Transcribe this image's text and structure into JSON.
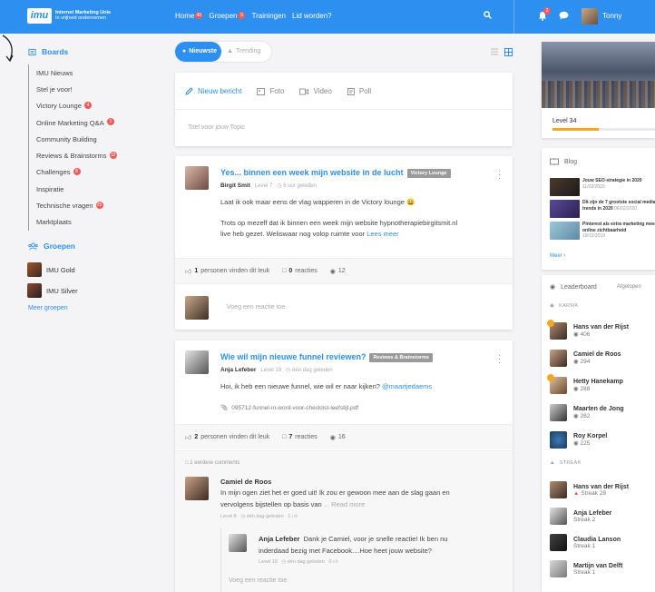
{
  "header": {
    "logo": "imu",
    "brand_title": "Internet Marketing Unie",
    "brand_sub": "In vrijheid ondernemen",
    "nav": [
      {
        "label": "Home",
        "badge": "40"
      },
      {
        "label": "Groepen",
        "badge": "9"
      },
      {
        "label": "Trainingen",
        "badge": ""
      },
      {
        "label": "Lid worden?",
        "badge": ""
      }
    ],
    "notif_count": "2",
    "user_name": "Tonny",
    "colors": {
      "primary": "#2d8ff0",
      "badge": "#f05a5a"
    }
  },
  "sidebar": {
    "boards_title": "Boards",
    "boards": [
      {
        "label": "IMU Nieuws",
        "badge": ""
      },
      {
        "label": "Stel je voor!",
        "badge": ""
      },
      {
        "label": "Victory Lounge",
        "badge": "4"
      },
      {
        "label": "Online Marketing Q&A",
        "badge": "3"
      },
      {
        "label": "Community Building",
        "badge": ""
      },
      {
        "label": "Reviews & Brainstorms",
        "badge": "15"
      },
      {
        "label": "Challenges",
        "badge": "8"
      },
      {
        "label": "Inspiratie",
        "badge": ""
      },
      {
        "label": "Technische vragen",
        "badge": "25"
      },
      {
        "label": "Marktplaats",
        "badge": ""
      }
    ],
    "groups_title": "Groepen",
    "groups": [
      {
        "label": "IMU Gold"
      },
      {
        "label": "IMU Silver"
      }
    ],
    "more_groups": "Meer groepen"
  },
  "feed": {
    "tabs": [
      {
        "label": "Nieuwste"
      },
      {
        "label": "Trending"
      }
    ],
    "composer": {
      "tabs": [
        "Nieuw bericht",
        "Foto",
        "Video",
        "Poll"
      ],
      "placeholder": "Titel voor jouw Topic"
    },
    "posts": [
      {
        "title": "Yes... binnen een week mijn website in de lucht",
        "tag": "Victory Lounge",
        "author": "Birgit Smit",
        "level": "Level 7",
        "time": "6 uur geleden",
        "line1": "Laat ik ook maar eens de vlag wapperen in de Victory lounge 😀",
        "line2": "Trots op mezelf dat ik binnen een week mijn website hypnotherapiebirgitsmit.nl",
        "line3": "live heb gezet. Weliswaar nog volop ruimte voor",
        "read_more": "Lees meer",
        "likes": "1",
        "likes_text": "personen vinden dit leuk",
        "comments": "0",
        "comments_text": "reacties",
        "views": "12",
        "reply_placeholder": "Voeg een reactie toe"
      },
      {
        "title": "Wie wil mijn nieuwe funnel reviewen?",
        "tag": "Reviews & Brainstorms",
        "author": "Anja Lefeber",
        "level": "Level 19",
        "time": "één dag geleden",
        "line1": "Hoi, ik heb een nieuwe funnel, wie wil er naar kijken?",
        "mention": "@maartjedaems",
        "attachment": "095712-funnel-in-word-voor-checklist-leefstijl.pdf",
        "likes": "2",
        "likes_text": "personen vinden dit leuk",
        "comments": "7",
        "comments_text": "reacties",
        "views": "16",
        "earlier_comments": "1 eerdere comments",
        "comments_list": [
          {
            "name": "Camiel de Roos",
            "line1": "In mijn ogen ziet het er goed uit! Ik zou er gewoon mee aan de slag gaan en",
            "line2": "vervolgens bijstellen op basis van",
            "read_more": "... Read more",
            "level": "Level 8",
            "time": "één dag geleden",
            "likes": "1"
          },
          {
            "name": "Anja Lefeber",
            "line1": "Dank je Camiel, voor je snelle reactie! Ik ben nu",
            "line2": "inderdaad bezig met Facebook....Hoe heet jouw website?",
            "level": "Level 19",
            "time": "één dag geleden",
            "likes": "0"
          }
        ],
        "reply_placeholder": "Voeg een reactie toe"
      }
    ]
  },
  "right": {
    "level": "Level 34",
    "level_progress": 0.45,
    "blog_title": "Blog",
    "blog": [
      {
        "title": "Jouw SEO-strategie in 2020",
        "date": "11/02/2020"
      },
      {
        "title": "Dit zijn de 7 grootste social media trends in 2020",
        "date": "06/02/2020"
      },
      {
        "title": "Pinterest als extra marketing meer online zichtbaarheid",
        "date": "19/12/2019"
      }
    ],
    "blog_more": "Meer",
    "leaderboard_title": "Leaderboard",
    "leaderboard_filter": "Afgelopen",
    "karma_label": "KARMA",
    "karma": [
      {
        "name": "Hans van der Rijst",
        "value": "406"
      },
      {
        "name": "Camiel de Roos",
        "value": "294"
      },
      {
        "name": "Hetty Hanekamp",
        "value": "288"
      },
      {
        "name": "Maarten de Jong",
        "value": "282"
      },
      {
        "name": "Roy Korpel",
        "value": "225"
      }
    ],
    "streak_label": "STREAK",
    "streak": [
      {
        "name": "Hans van der Rijst",
        "value": "Streak 28"
      },
      {
        "name": "Anja Lefeber",
        "value": "Streak 2"
      },
      {
        "name": "Claudia Lanson",
        "value": "Streak 1"
      },
      {
        "name": "Martijn van Delft",
        "value": "Streak 1"
      }
    ]
  }
}
